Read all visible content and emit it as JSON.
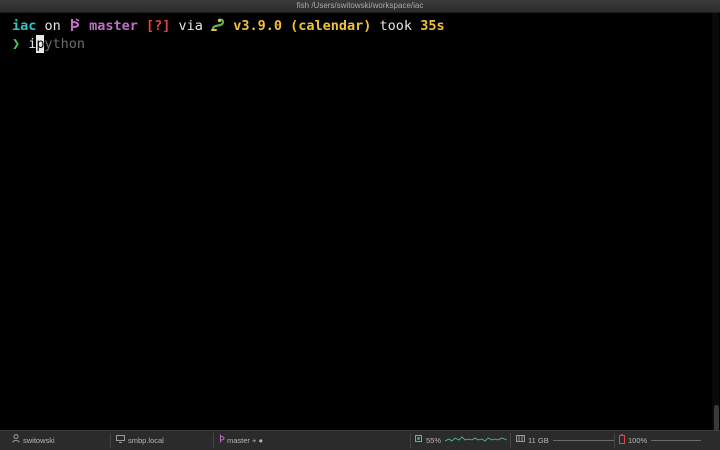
{
  "window": {
    "title": "fish /Users/switowski/workspace/iac"
  },
  "prompt": {
    "directory": "iac",
    "on_word": "on",
    "branch_icon": "git-branch-icon",
    "branch": "master",
    "status": "[?]",
    "via_word": "via",
    "python_icon": "python-snake-icon",
    "python_version": "v3.9.0",
    "virtualenv": "(calendar)",
    "took_word": "took",
    "duration": "35s"
  },
  "command": {
    "prompt_char": "❯",
    "typed_before_cursor": "i",
    "cursor_char": "p",
    "suggestion": "ython"
  },
  "statusbar": {
    "user": "switowski",
    "user_icon": "user-icon",
    "host": "smbp.local",
    "host_icon": "computer-icon",
    "git": "master + ●",
    "git_icon": "git-branch-icon",
    "cpu": "55%",
    "cpu_icon": "cpu-icon",
    "memory": "11 GB",
    "memory_icon": "memory-icon",
    "battery": "100%",
    "battery_icon": "battery-icon"
  }
}
